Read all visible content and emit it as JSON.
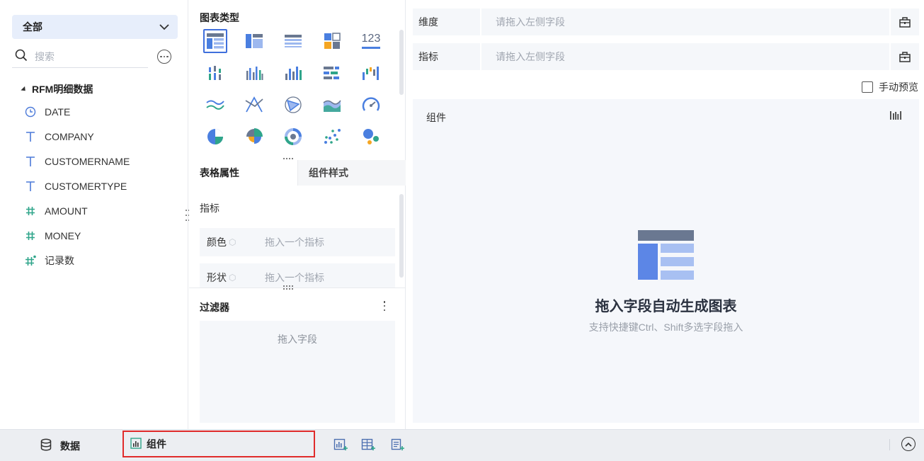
{
  "data_panel": {
    "dropdown_label": "全部",
    "search_placeholder": "搜索",
    "dataset_name": "RFM明细数据",
    "fields": [
      {
        "name": "DATE",
        "type": "date",
        "icon": "clock-icon"
      },
      {
        "name": "COMPANY",
        "type": "text",
        "icon": "text-type-icon"
      },
      {
        "name": "CUSTOMERNAME",
        "type": "text",
        "icon": "text-type-icon"
      },
      {
        "name": "CUSTOMERTYPE",
        "type": "text",
        "icon": "text-type-icon"
      },
      {
        "name": "AMOUNT",
        "type": "number",
        "icon": "hash-icon"
      },
      {
        "name": "MONEY",
        "type": "number",
        "icon": "hash-icon"
      },
      {
        "name": "记录数",
        "type": "number",
        "icon": "hash-calc-icon"
      }
    ]
  },
  "config_panel": {
    "chart_type_title": "图表类型",
    "chart_type_selected": "table",
    "chart_types": [
      "table",
      "cross-table",
      "detail-table",
      "heat-grid",
      "kpi-number",
      "grouped-column",
      "column",
      "multi-column",
      "bar",
      "waterfall",
      "line",
      "radar-line",
      "radar",
      "area",
      "gauge",
      "pie",
      "rose",
      "donut",
      "scatter",
      "bubble"
    ],
    "kpi_label": "123",
    "tabs": [
      {
        "label": "表格属性",
        "active": true
      },
      {
        "label": "组件样式",
        "active": false
      }
    ],
    "indicator_label": "指标",
    "properties": [
      {
        "name": "颜色",
        "placeholder": "拖入一个指标"
      },
      {
        "name": "形状",
        "placeholder": "拖入一个指标"
      }
    ],
    "filter_title": "过滤器",
    "filter_placeholder": "拖入字段"
  },
  "preview": {
    "dimension_label": "维度",
    "dimension_placeholder": "请拖入左侧字段",
    "measure_label": "指标",
    "measure_placeholder": "请拖入左侧字段",
    "manual_preview": "手动预览",
    "canvas_title": "组件",
    "empty_title": "拖入字段自动生成图表",
    "empty_subtitle": "支持快捷键Ctrl、Shift多选字段拖入"
  },
  "bottom_bar": {
    "data_tab": "数据",
    "component_tab": "组件"
  },
  "colors": {
    "accent": "#3f6fdc",
    "highlight_border": "#e02b2b",
    "number_field": "#2fa58a"
  }
}
